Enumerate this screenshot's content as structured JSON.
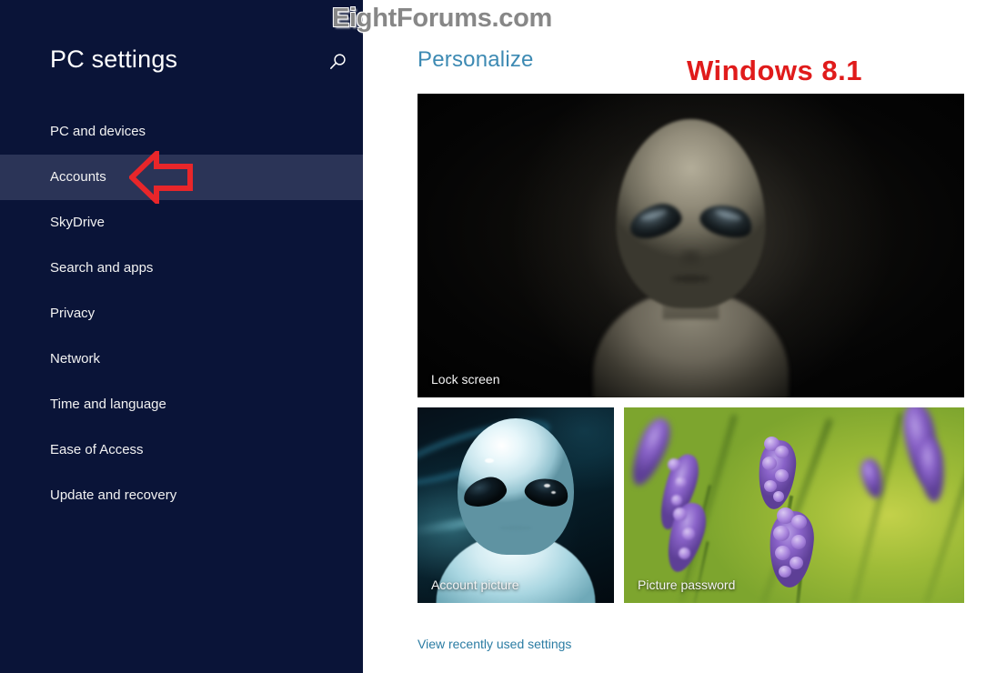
{
  "sidebar": {
    "title": "PC settings",
    "search_icon": "search-icon",
    "items": [
      {
        "label": "PC and devices",
        "selected": false
      },
      {
        "label": "Accounts",
        "selected": true
      },
      {
        "label": "SkyDrive",
        "selected": false
      },
      {
        "label": "Search and apps",
        "selected": false
      },
      {
        "label": "Privacy",
        "selected": false
      },
      {
        "label": "Network",
        "selected": false
      },
      {
        "label": "Time and language",
        "selected": false
      },
      {
        "label": "Ease of Access",
        "selected": false
      },
      {
        "label": "Update and recovery",
        "selected": false
      }
    ]
  },
  "main": {
    "page_title": "Personalize",
    "version_badge": "Windows 8.1",
    "recent_link": "View recently used settings",
    "tiles": [
      {
        "label": "Lock screen",
        "image": "grey-alien-dark-portrait"
      },
      {
        "label": "Account picture",
        "image": "glossy-white-alien"
      },
      {
        "label": "Picture password",
        "image": "lavender-flowers"
      }
    ]
  },
  "annotations": {
    "watermark": "EightForums.com",
    "arrow": "left-pointing-red-arrow"
  },
  "colors": {
    "sidebar_bg": "#0a1438",
    "sidebar_selected": "#2b3457",
    "page_title": "#3d8ab3",
    "link": "#2b7ca3",
    "version_badge": "#e01b1b",
    "watermark": "#878787",
    "annotation_arrow": "#e8262a"
  }
}
